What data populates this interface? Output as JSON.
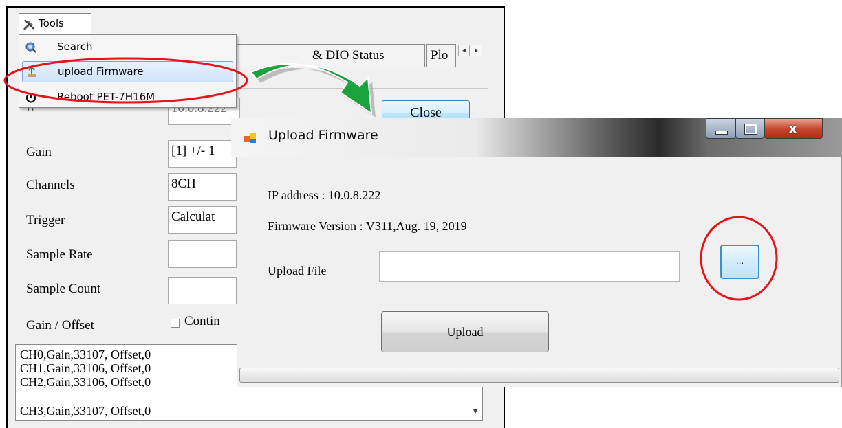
{
  "background_window": {
    "tools_menu_label": "Tools",
    "tabs": [
      "& DIO Status",
      "Plo"
    ],
    "close_label": "Close",
    "ip_value": "10.0.8.222",
    "ip_label_partial": "IP",
    "fields": [
      {
        "label": "Gain",
        "value": "[1] +/- 1"
      },
      {
        "label": "Channels",
        "value": "8CH"
      },
      {
        "label": "Trigger",
        "value": "Calculat"
      },
      {
        "label": "Sample Rate",
        "value": ""
      },
      {
        "label": "Sample Count",
        "value": ""
      }
    ],
    "gain_offset_label": "Gain / Offset",
    "continuous_checkbox_label": "Contin",
    "gain_offset_lines": [
      "CH0,Gain,33107, Offset,0",
      "CH1,Gain,33106, Offset,0",
      "CH2,Gain,33106, Offset,0",
      "CH3,Gain,33107, Offset,0"
    ]
  },
  "tools_menu": {
    "items": [
      {
        "label": "Search",
        "icon": "search-icon"
      },
      {
        "label": "upload Firmware",
        "icon": "upload-icon"
      },
      {
        "label": "Reboot PET-7H16M",
        "icon": "power-icon"
      }
    ]
  },
  "dialog": {
    "title": "Upload Firmware",
    "ip_address_line": "IP  address : 10.0.8.222",
    "firmware_version_line": "Firmware Version : V311,Aug. 19, 2019",
    "upload_file_label": "Upload File",
    "upload_file_value": "",
    "browse_label": "...",
    "upload_button_label": "Upload"
  },
  "colors": {
    "annotation_red": "#e8141c",
    "arrow_green": "#1aa33c",
    "selection_blue": "#cfe3f9"
  }
}
